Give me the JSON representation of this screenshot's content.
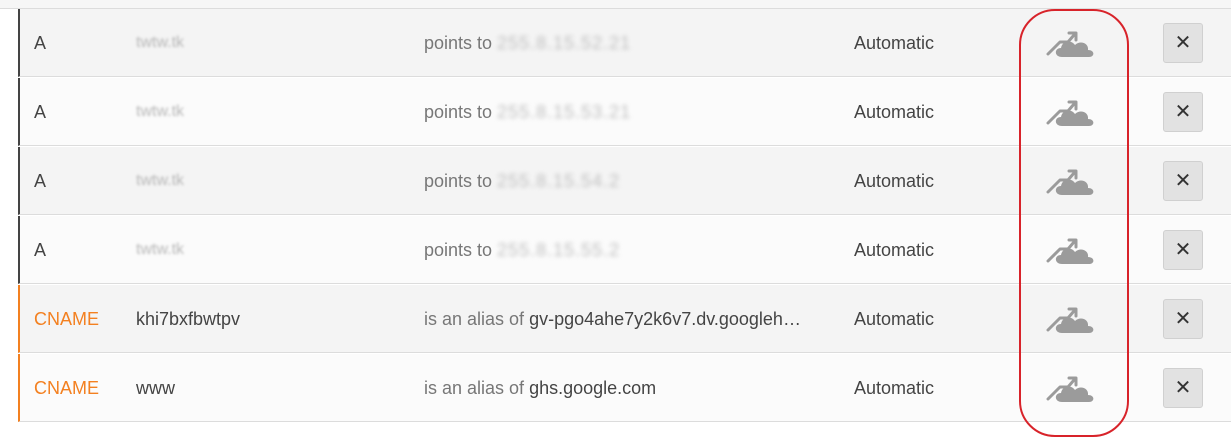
{
  "rows": [
    {
      "type": "A",
      "name": "twtw.tk",
      "prefix": "points to",
      "target": "255.8.15.52.21",
      "ttl": "Automatic",
      "proxy_icon": "cloud-proxy-icon",
      "delete_label": "✕"
    },
    {
      "type": "A",
      "name": "twtw.tk",
      "prefix": "points to",
      "target": "255.8.15.53.21",
      "ttl": "Automatic",
      "proxy_icon": "cloud-proxy-icon",
      "delete_label": "✕"
    },
    {
      "type": "A",
      "name": "twtw.tk",
      "prefix": "points to",
      "target": "255.8.15.54.2",
      "ttl": "Automatic",
      "proxy_icon": "cloud-proxy-icon",
      "delete_label": "✕"
    },
    {
      "type": "A",
      "name": "twtw.tk",
      "prefix": "points to",
      "target": "255.8.15.55.2",
      "ttl": "Automatic",
      "proxy_icon": "cloud-proxy-icon",
      "delete_label": "✕"
    },
    {
      "type": "CNAME",
      "name": "khi7bxfbwtpv",
      "prefix": "is an alias of",
      "target": "gv-pgo4ahe7y2k6v7.dv.googleh…",
      "ttl": "Automatic",
      "proxy_icon": "cloud-proxy-icon",
      "delete_label": "✕"
    },
    {
      "type": "CNAME",
      "name": "www",
      "prefix": "is an alias of",
      "target": "ghs.google.com",
      "ttl": "Automatic",
      "proxy_icon": "cloud-proxy-icon",
      "delete_label": "✕"
    }
  ],
  "colors": {
    "accent_cname": "#f38020",
    "highlight": "#d8232a",
    "cloud_grey": "#9b9b9b"
  }
}
